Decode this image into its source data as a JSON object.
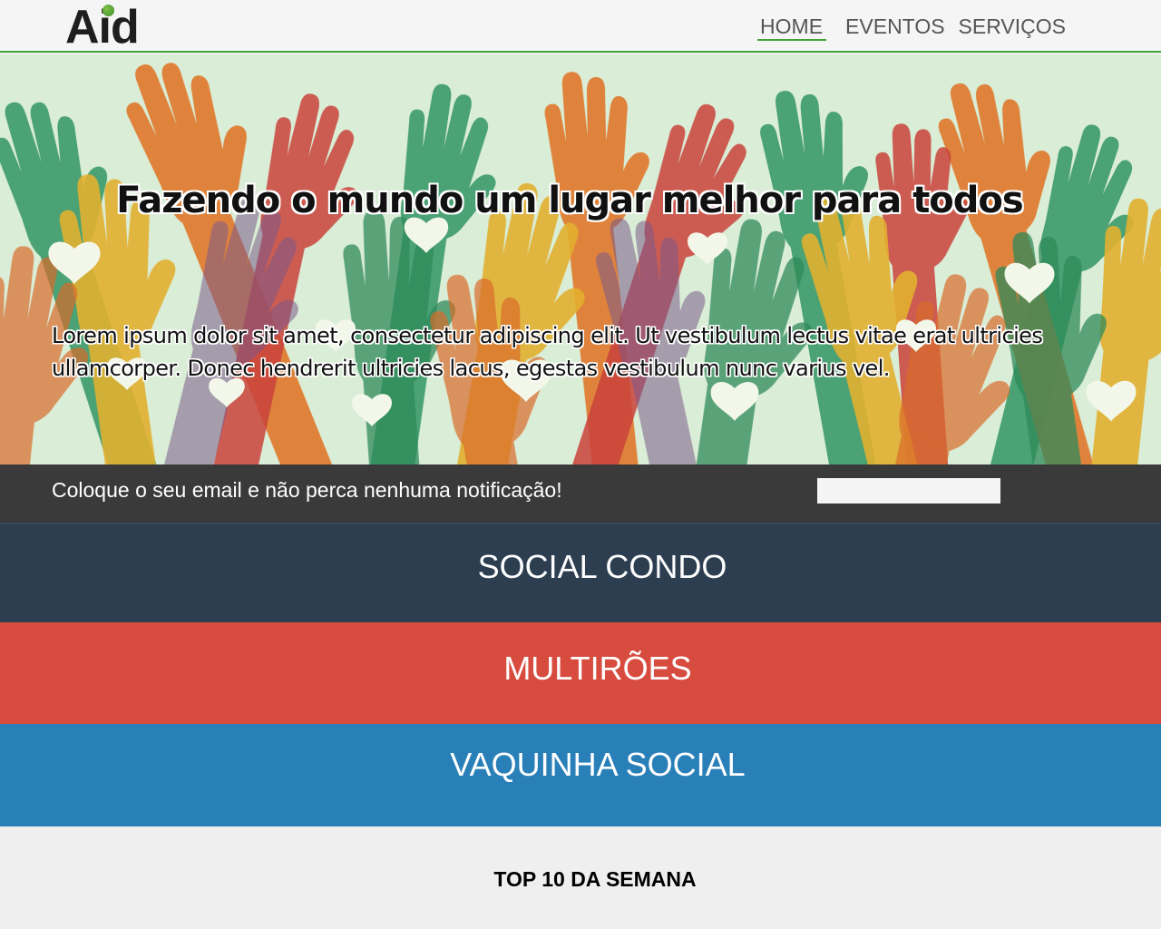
{
  "header": {
    "logo_text": "Aid",
    "nav": [
      {
        "label": "HOME",
        "active": true
      },
      {
        "label": "EVENTOS",
        "active": false
      },
      {
        "label": "SERVIÇOS",
        "active": false
      }
    ]
  },
  "hero": {
    "title": "Fazendo o mundo um lugar melhor para todos",
    "text": "Lorem ipsum dolor sit amet, consectetur adipiscing elit. Ut vestibulum lectus vitae erat ultricies ullamcorper. Donec hendrerit ultricies lacus, egestas vestibulum nunc varius vel."
  },
  "subscribe": {
    "text": "Coloque o seu email e não perca nenhuma notificação!",
    "input_value": "",
    "input_placeholder": ""
  },
  "sections": [
    {
      "label": "SOCIAL CONDO",
      "color": "#2c3e50"
    },
    {
      "label": "MULTIRÕES",
      "color": "#d84b3f"
    },
    {
      "label": "VAQUINHA SOCIAL",
      "color": "#2980b9"
    }
  ],
  "top10": {
    "title": "TOP 10 DA SEMANA"
  },
  "colors": {
    "accent": "#3fa535",
    "nav_text": "#555555",
    "subscribe_bg": "#3a3a3a"
  }
}
